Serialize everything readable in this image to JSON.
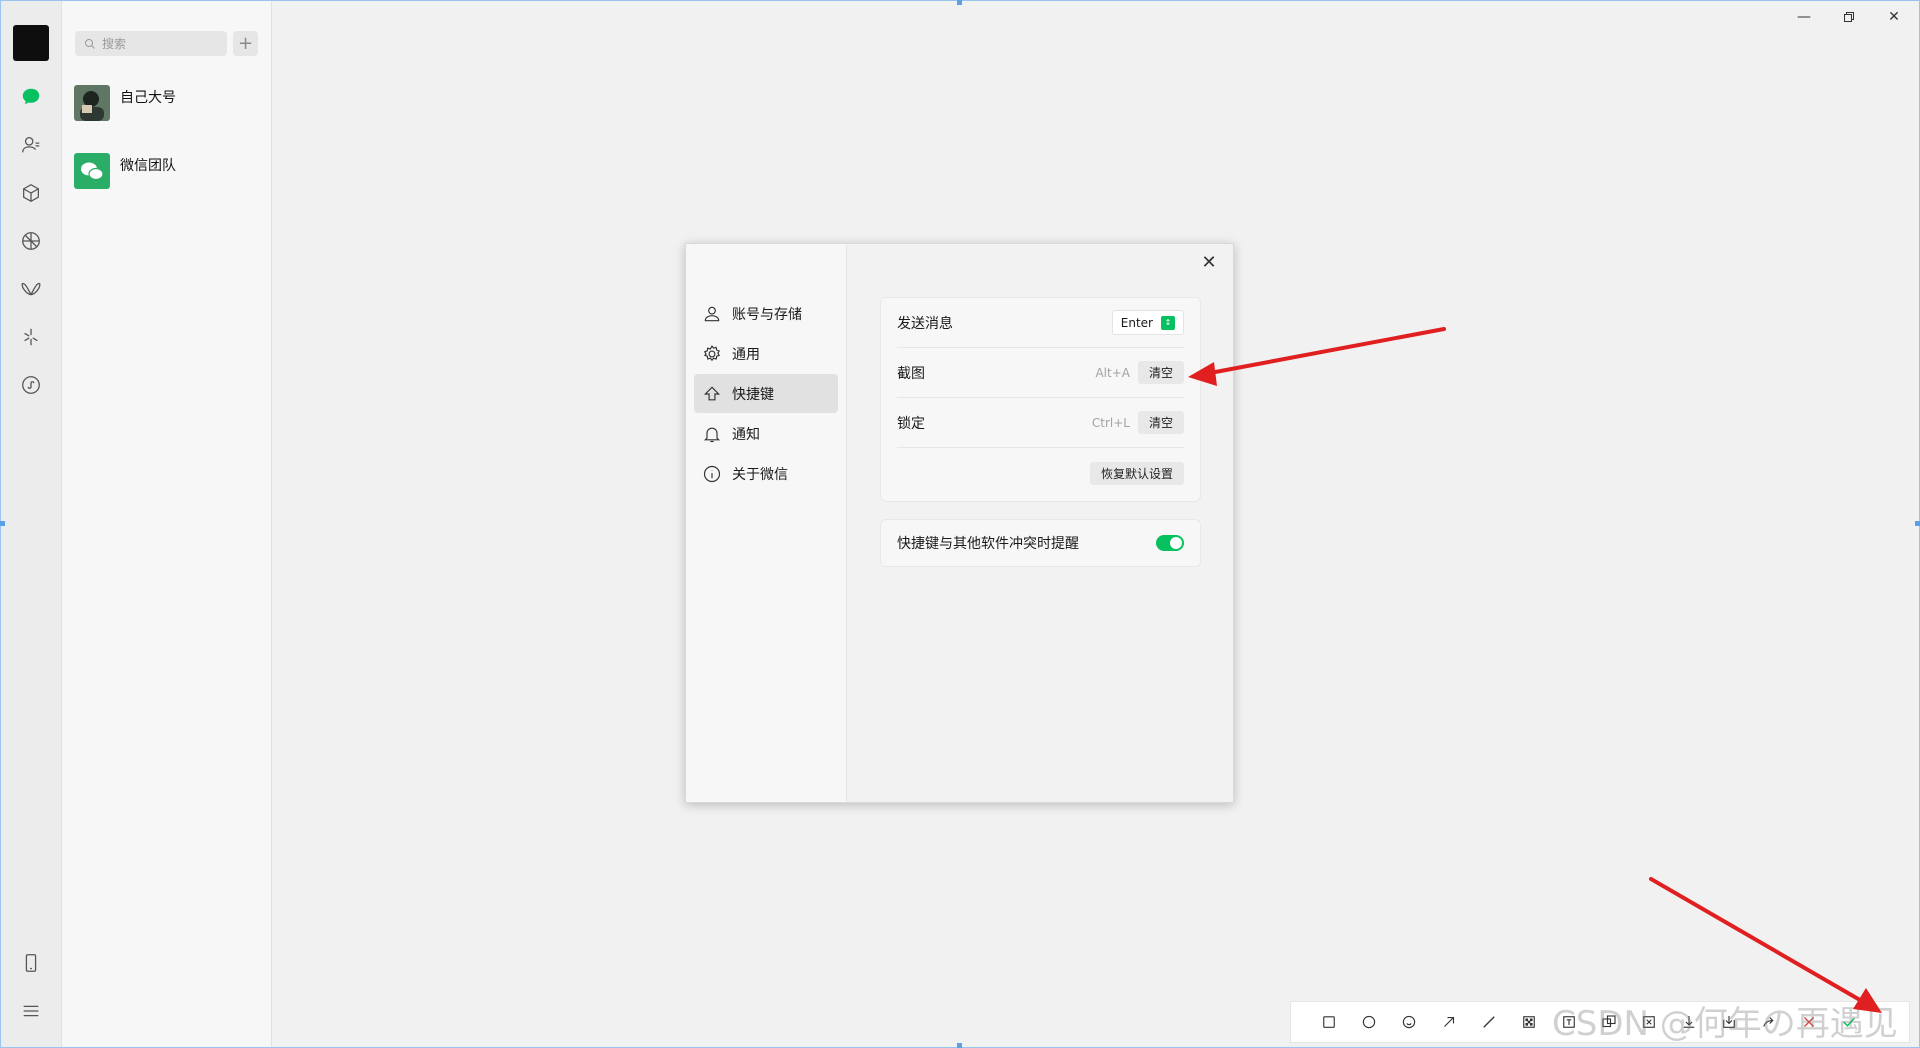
{
  "search": {
    "placeholder": "搜索"
  },
  "chats": [
    {
      "name": "自己大号"
    },
    {
      "name": "微信团队"
    }
  ],
  "dialog": {
    "nav": [
      {
        "label": "账号与存储"
      },
      {
        "label": "通用"
      },
      {
        "label": "快捷键"
      },
      {
        "label": "通知"
      },
      {
        "label": "关于微信"
      }
    ],
    "shortcuts": {
      "send_label": "发送消息",
      "send_value": "Enter",
      "screenshot_label": "截图",
      "screenshot_key": "Alt+A",
      "lock_label": "锁定",
      "lock_key": "Ctrl+L",
      "clear_label": "清空",
      "restore_label": "恢复默认设置"
    },
    "conflict": {
      "label": "快捷键与其他软件冲突时提醒",
      "enabled": true
    }
  },
  "watermark": "CSDN @何年の再遇见",
  "colors": {
    "accent": "#07c160",
    "arrow": "#e02020"
  }
}
